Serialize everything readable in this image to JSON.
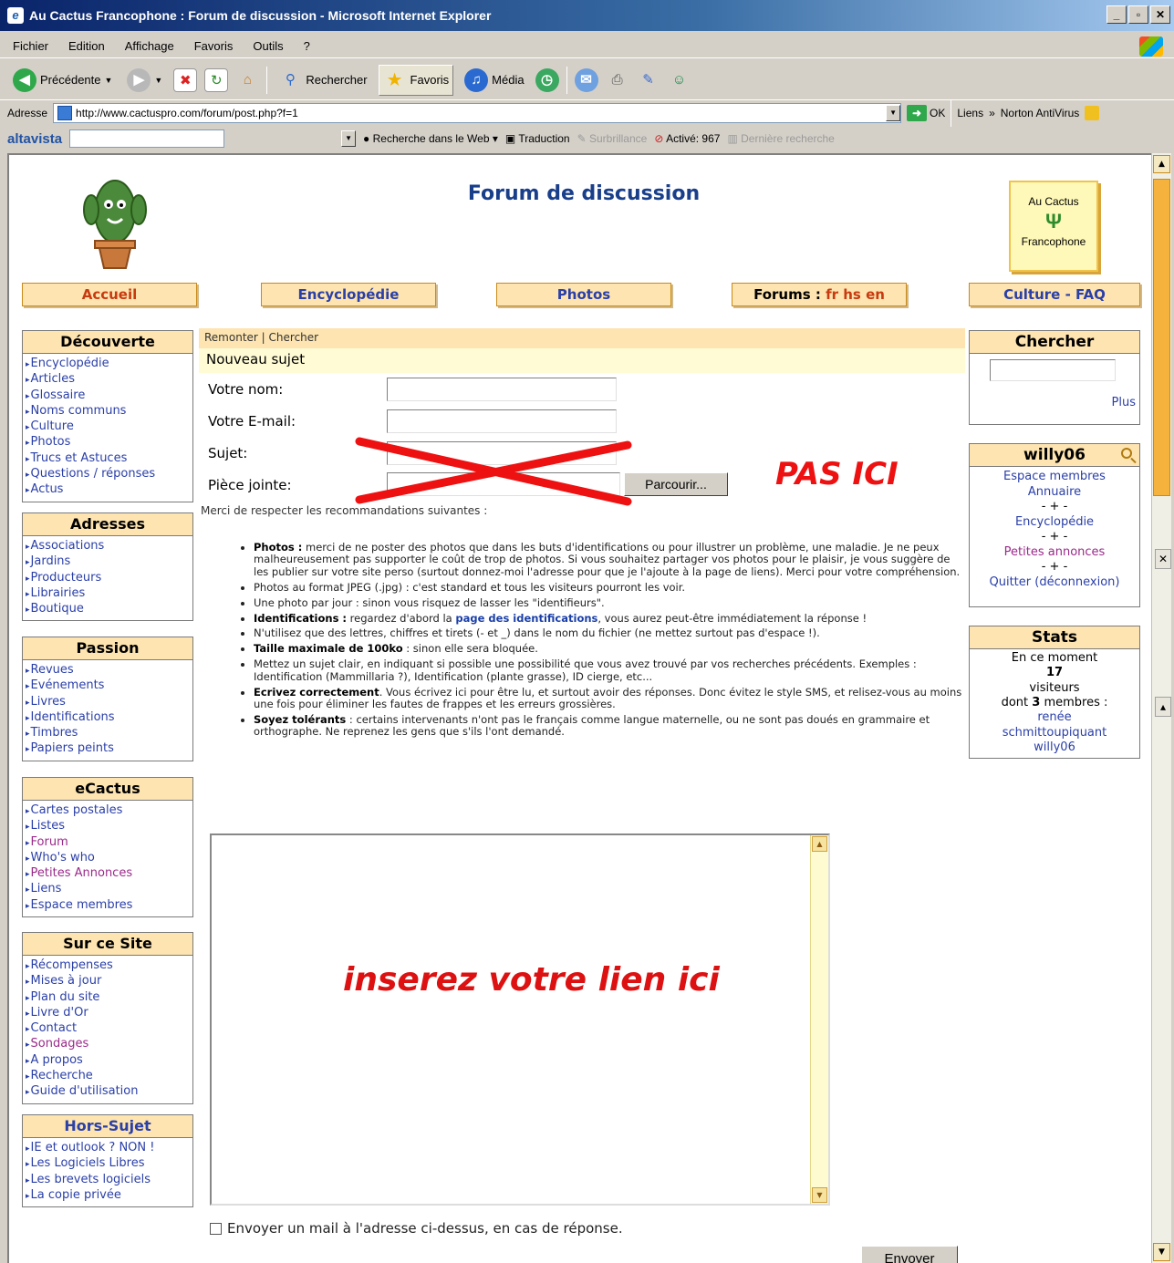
{
  "window": {
    "title": "Au Cactus Francophone : Forum de discussion - Microsoft Internet Explorer",
    "controls": [
      "_",
      "▫",
      "✕"
    ]
  },
  "menu": [
    "Fichier",
    "Edition",
    "Affichage",
    "Favoris",
    "Outils",
    "?"
  ],
  "toolbar": {
    "back": "Précédente",
    "search": "Rechercher",
    "favorites": "Favoris",
    "media": "Média"
  },
  "address": {
    "label": "Adresse",
    "url": "http://www.cactuspro.com/forum/post.php?f=1",
    "go": "OK",
    "links": "Liens",
    "links_chevron": "»",
    "norton": "Norton AntiVirus"
  },
  "altavista": {
    "logo": "altavista",
    "search_web": "Recherche dans le Web",
    "translate": "Traduction",
    "highlight": "Surbrillance",
    "active": "Activé: 967",
    "last_search": "Dernière recherche"
  },
  "page": {
    "title": "Forum de discussion",
    "brand_line1": "Au Cactus",
    "brand_line2": "Francophone",
    "nav": {
      "home": "Accueil",
      "encyclopedia": "Encyclopédie",
      "photos": "Photos",
      "forums_prefix": "Forums : ",
      "forums_langs": "fr hs en",
      "culture": "Culture - FAQ"
    },
    "sidebar": {
      "decouverte": {
        "title": "Découverte",
        "items": [
          "Encyclopédie",
          "Articles",
          "Glossaire",
          "Noms communs",
          "Culture",
          "Photos",
          "Trucs et Astuces",
          "Questions / réponses",
          "Actus"
        ]
      },
      "adresses": {
        "title": "Adresses",
        "items": [
          "Associations",
          "Jardins",
          "Producteurs",
          "Librairies",
          "Boutique"
        ]
      },
      "passion": {
        "title": "Passion",
        "items": [
          "Revues",
          "Evénements",
          "Livres",
          "Identifications",
          "Timbres",
          "Papiers peints"
        ]
      },
      "ecactus": {
        "title": "eCactus",
        "items": [
          "Cartes postales",
          "Listes",
          "Forum",
          "Who's who",
          "Petites Annonces",
          "Liens",
          "Espace membres"
        ]
      },
      "site": {
        "title": "Sur ce Site",
        "items": [
          "Récompenses",
          "Mises à jour",
          "Plan du site",
          "Livre d'Or",
          "Contact",
          "Sondages",
          "A propos",
          "Recherche",
          "Guide d'utilisation"
        ]
      },
      "horssujet": {
        "title": "Hors-Sujet",
        "items": [
          "IE et outlook ? NON !",
          "Les Logiciels Libres",
          "Les brevets logiciels",
          "La copie privée"
        ]
      }
    },
    "right": {
      "search_title": "Chercher",
      "search_more": "Plus",
      "user_title": "willy06",
      "user_links": [
        "Espace membres",
        "Annuaire",
        "- + -",
        "Encyclopédie",
        "- + -",
        "Petites annonces",
        "- + -",
        "Quitter (déconnexion)"
      ],
      "stats_title": "Stats",
      "stats_now": "En ce moment",
      "stats_count": "17",
      "stats_visitors": "visiteurs",
      "stats_members_prefix": "dont ",
      "stats_members_count": "3",
      "stats_members_suffix": " membres :",
      "members": [
        "renée",
        "schmittoupiquant",
        "willy06"
      ]
    },
    "form": {
      "crumb_up": "Remonter",
      "crumb_sep": "|",
      "crumb_search": "Chercher",
      "heading": "Nouveau sujet",
      "name_label": "Votre nom:",
      "email_label": "Votre E-mail:",
      "subject_label": "Sujet:",
      "attach_label": "Pièce jointe:",
      "browse": "Parcourir...",
      "annotation_not_here": "PAS ICI",
      "intro": "Merci de respecter les recommandations suivantes :",
      "rules": [
        {
          "bold": "Photos :",
          "text": " merci de ne poster des photos que dans les buts d'identifications ou pour illustrer un problème, une maladie. Je ne peux malheureusement pas supporter le coût de trop de photos. Si vous souhaitez partager vos photos pour le plaisir, je vous suggère de les publier sur votre site perso (surtout donnez-moi l'adresse pour que je l'ajoute à la page de liens). Merci pour votre compréhension."
        },
        {
          "bold": "",
          "text": "Photos au format JPEG (.jpg) : c'est standard et tous les visiteurs pourront les voir."
        },
        {
          "bold": "",
          "text": "Une photo par jour : sinon vous risquez de lasser les \"identifieurs\"."
        },
        {
          "bold": "Identifications :",
          "text": " regardez d'abord la ",
          "link": "page des identifications",
          "after": ", vous aurez peut-être immédiatement la réponse !"
        },
        {
          "bold": "",
          "text": "N'utilisez que des lettres, chiffres et tirets (- et _) dans le nom du fichier (ne mettez surtout pas d'espace !)."
        },
        {
          "bold": "Taille maximale de 100ko",
          "text": " : sinon elle sera bloquée."
        },
        {
          "bold": "",
          "text": "Mettez un sujet clair, en indiquant si possible une possibilité que vous avez trouvé par vos recherches précédents. Exemples : Identification (Mammillaria ?), Identification (plante grasse), ID cierge, etc..."
        },
        {
          "bold": "Ecrivez correctement",
          "text": ". Vous écrivez ici pour être lu, et surtout avoir des réponses. Donc évitez le style SMS, et relisez-vous au moins une fois pour éliminer les fautes de frappes et les erreurs grossières."
        },
        {
          "bold": "Soyez tolérants",
          "text": " : certains intervenants n'ont pas le français comme langue maternelle, ou ne sont pas doués en grammaire et orthographe. Ne reprenez les gens que s'ils l'ont demandé."
        }
      ],
      "annotation_insert": "inserez votre lien ici",
      "notify_label": "Envoyer un mail à l'adresse ci-dessus, en cas de réponse.",
      "submit": "Envoyer"
    }
  }
}
